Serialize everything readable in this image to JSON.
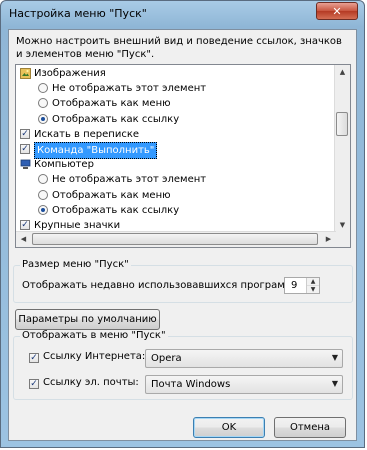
{
  "window": {
    "title": "Настройка меню \"Пуск\"",
    "close_label": "✕"
  },
  "description": "Можно настроить внешний вид и поведение ссылок, значков и элементов меню \"Пуск\".",
  "list": {
    "items": [
      {
        "kind": "icon",
        "label": "Изображения",
        "icon": "pictures-folder-icon"
      },
      {
        "kind": "radio",
        "label": "Не отображать этот элемент",
        "checked": false
      },
      {
        "kind": "radio",
        "label": "Отображать как меню",
        "checked": false
      },
      {
        "kind": "radio",
        "label": "Отображать как ссылку",
        "checked": true
      },
      {
        "kind": "checkbox",
        "label": "Искать в переписке",
        "checked": true
      },
      {
        "kind": "checkbox",
        "label": "Команда \"Выполнить\"",
        "checked": true,
        "selected": true
      },
      {
        "kind": "icon",
        "label": "Компьютер",
        "icon": "computer-icon"
      },
      {
        "kind": "radio",
        "label": "Не отображать этот элемент",
        "checked": false
      },
      {
        "kind": "radio",
        "label": "Отображать как меню",
        "checked": false
      },
      {
        "kind": "radio",
        "label": "Отображать как ссылку",
        "checked": true
      },
      {
        "kind": "checkbox",
        "label": "Крупные значки",
        "checked": true
      }
    ],
    "scroll_position": 0.55
  },
  "menu_size": {
    "group_label": "Размер меню \"Пуск\"",
    "recent_label": "Отображать недавно использовавшихся программ:",
    "recent_value": "9"
  },
  "defaults_button": "Параметры по умолчанию",
  "show_in_menu": {
    "group_label": "Отображать в меню \"Пуск\"",
    "internet_label": "Ссылку Интернета:",
    "internet_checked": true,
    "internet_value": "Opera",
    "email_label": "Ссылку эл. почты:",
    "email_checked": true,
    "email_value": "Почта Windows"
  },
  "buttons": {
    "ok": "OK",
    "cancel": "Отмена"
  },
  "colors": {
    "selection": "#3399ff",
    "title_bar": "#9cc3e2",
    "close_button": "#c8553f"
  }
}
